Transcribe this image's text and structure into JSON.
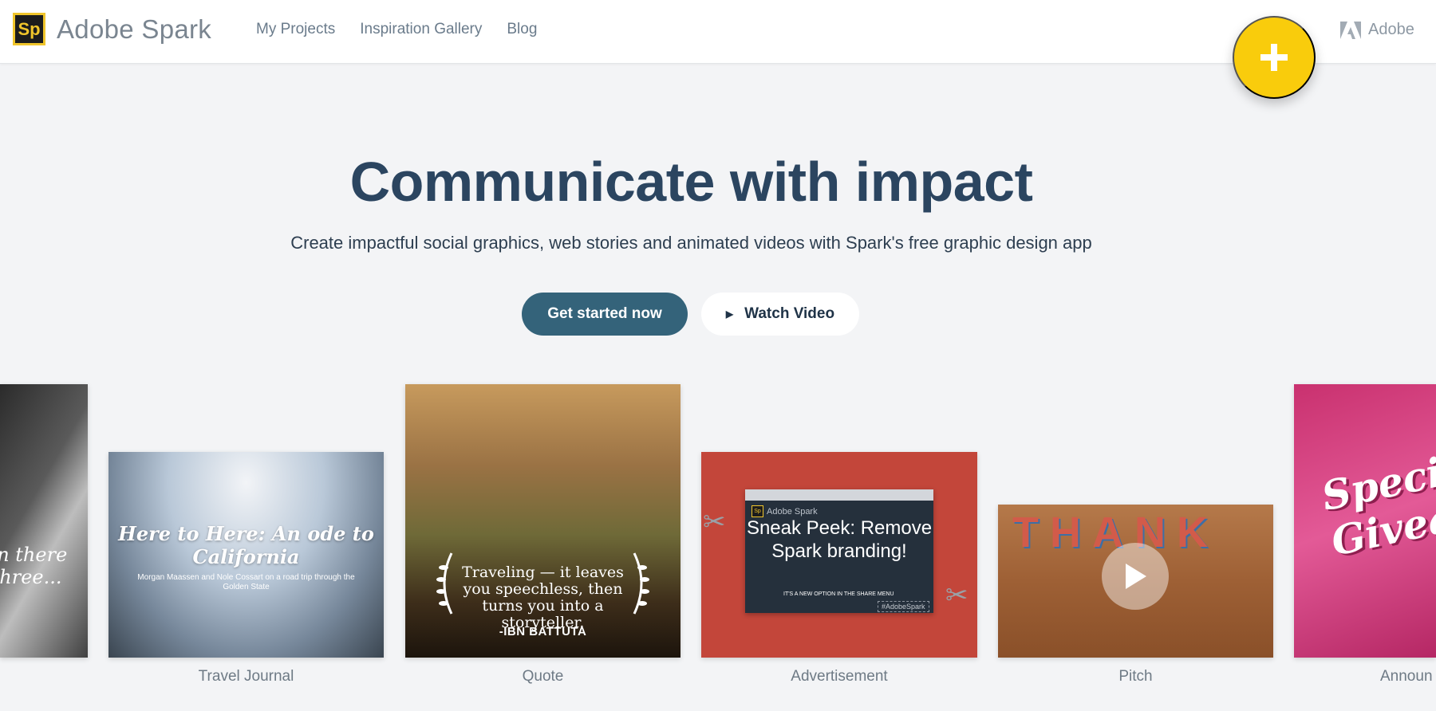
{
  "header": {
    "logo_text": "Sp",
    "brand": "Adobe Spark",
    "nav": [
      "My Projects",
      "Inspiration Gallery",
      "Blog"
    ],
    "fab_icon": "plus-icon",
    "adobe_label": "Adobe"
  },
  "hero": {
    "title": "Communicate with impact",
    "subtitle": "Create impactful social graphics, web stories and animated videos with Spark's free graphic design app",
    "primary_button": "Get started now",
    "secondary_button": "Watch Video"
  },
  "cards": {
    "hand": {
      "text": "en there\n three..."
    },
    "travel": {
      "label": "Travel Journal",
      "title": "Here to Here: An ode to California",
      "subtitle": "Morgan Maassen and Nole Cossart on a road trip through the Golden State"
    },
    "quote": {
      "label": "Quote",
      "text": "Traveling — it leaves you speechless, then turns you into a storyteller.",
      "author": "-IBN BATTUTA"
    },
    "advertisement": {
      "label": "Advertisement",
      "brand": "Adobe Spark",
      "headline": "Sneak Peek: Remove Spark branding!",
      "note": "IT'S A NEW OPTION IN THE SHARE MENU",
      "tag": "#AdobeSpark"
    },
    "pitch": {
      "label": "Pitch",
      "letters": "THANK"
    },
    "announcement": {
      "label": "Announ",
      "text": "Speci\nGivea"
    }
  },
  "colors": {
    "accent_yellow": "#f9cc0c",
    "primary_button": "#34637a",
    "title": "#2b4560",
    "background": "#f3f4f6"
  }
}
